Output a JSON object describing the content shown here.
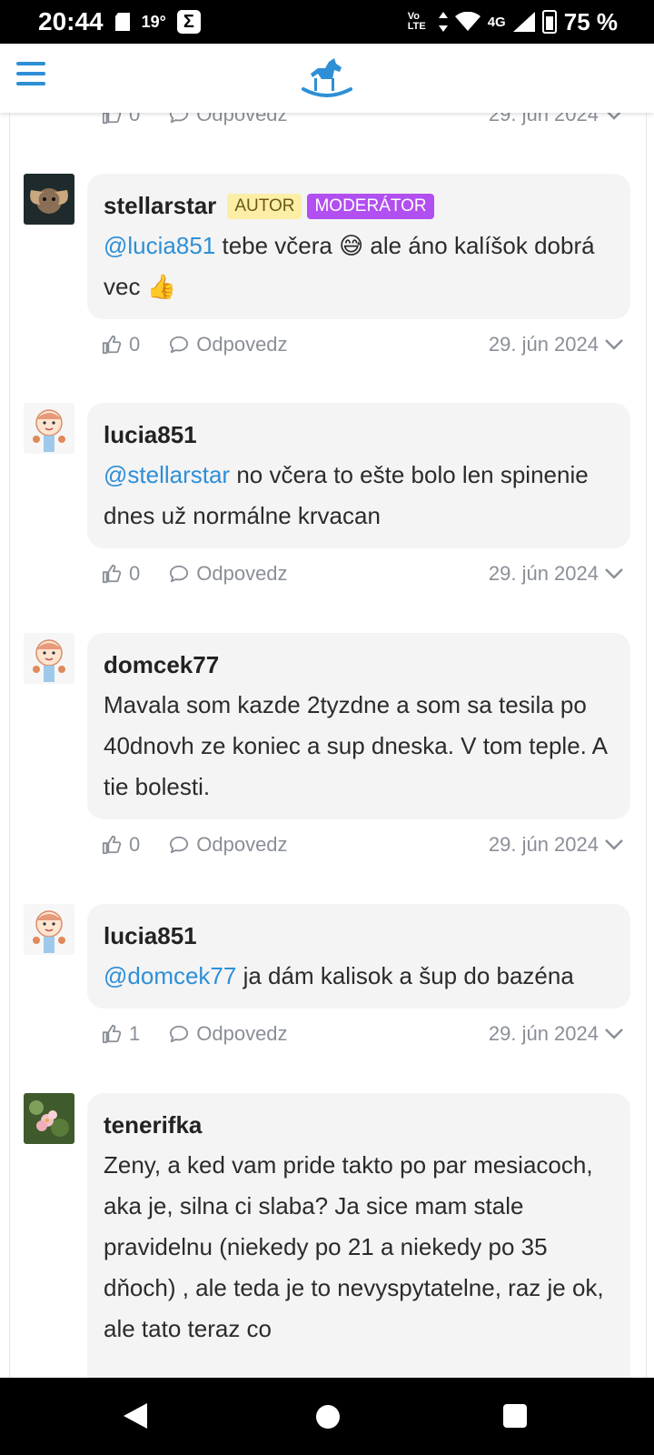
{
  "status_bar": {
    "time": "20:44",
    "temperature": "19°",
    "network": "4G",
    "volte": "Vo LTE",
    "battery": "75 %"
  },
  "app": {
    "menu_icon": "hamburger-menu-icon",
    "logo_icon": "rocking-horse-logo-icon",
    "accent_color": "#2e8fd6"
  },
  "top_partial_actions": {
    "likes": "0",
    "reply_label": "Odpovedz",
    "date": "29. jún 2024"
  },
  "comments": [
    {
      "author": "stellarstar",
      "badges": [
        "AUTOR",
        "MODERÁTOR"
      ],
      "mention": "@lucia851",
      "text": " tebe včera 😅 ale áno kalíšok dobrá vec 👍",
      "likes": "0",
      "reply_label": "Odpovedz",
      "date": "29. jún 2024"
    },
    {
      "author": "lucia851",
      "mention": "@stellarstar",
      "text": " no včera to ešte bolo len spinenie dnes už normálne krvacan",
      "likes": "0",
      "reply_label": "Odpovedz",
      "date": "29. jún 2024"
    },
    {
      "author": "domcek77",
      "mention": "",
      "text": "Mavala som kazde 2tyzdne a som sa tesila po 40dnovh ze koniec a sup dneska. V tom teple. A tie bolesti.",
      "likes": "0",
      "reply_label": "Odpovedz",
      "date": "29. jún 2024"
    },
    {
      "author": "lucia851",
      "mention": "@domcek77",
      "text": " ja dám kalisok a šup do bazéna",
      "likes": "1",
      "reply_label": "Odpovedz",
      "date": "29. jún 2024"
    },
    {
      "author": "tenerifka",
      "mention": "",
      "text": "Zeny, a ked vam pride takto po par mesiacoch, aka je, silna ci slaba? Ja sice mam stale pravidelnu (niekedy po 21 a niekedy po 35 dňoch) , ale teda je to nevyspytatelne, raz je ok, ale tato teraz co"
    }
  ]
}
